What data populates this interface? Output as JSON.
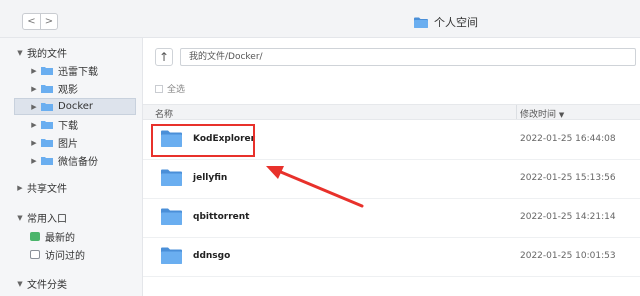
{
  "window": {
    "title": "个人空间"
  },
  "nav": {
    "back_glyph": "<",
    "forward_glyph": ">"
  },
  "sidebar": {
    "my_files": "我的文件",
    "items": [
      {
        "label": "迅雷下载"
      },
      {
        "label": "观影"
      },
      {
        "label": "Docker"
      },
      {
        "label": "下载"
      },
      {
        "label": "图片"
      },
      {
        "label": "微信备份"
      }
    ],
    "shared": "共享文件",
    "common_entry": "常用入口",
    "latest": "最新的",
    "visited": "访问过的",
    "categories": "文件分类"
  },
  "toolbar": {
    "up_glyph": "↑",
    "path": "我的文件/Docker/"
  },
  "list": {
    "select_all": "全选",
    "col_name": "名称",
    "col_modified": "修改时间",
    "rows": [
      {
        "name": "KodExplorer",
        "modified": "2022-01-25 16:44:08"
      },
      {
        "name": "jellyfin",
        "modified": "2022-01-25 15:13:56"
      },
      {
        "name": "qbittorrent",
        "modified": "2022-01-25 14:21:14"
      },
      {
        "name": "ddnsgo",
        "modified": "2022-01-25 10:01:53"
      }
    ]
  },
  "colors": {
    "folder": "#6aaef0",
    "folder_dark": "#4a8fd8",
    "highlight": "#e8312b",
    "selected": "#dde3ec"
  }
}
